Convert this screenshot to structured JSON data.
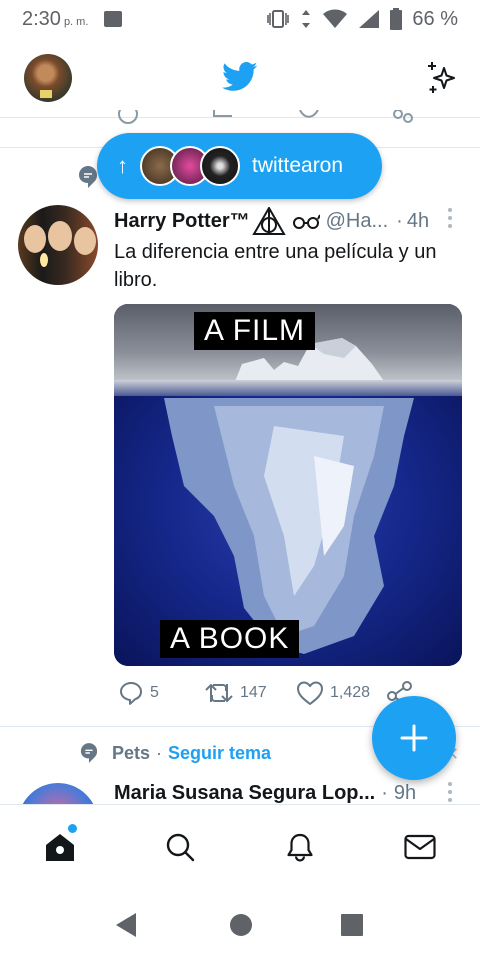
{
  "status_bar": {
    "time": "2:30",
    "ampm": "p. m.",
    "battery": "66 %"
  },
  "header": {
    "logo_icon": "twitter-bird-icon",
    "right_icon": "sparkle-icon"
  },
  "new_tweets_pill": {
    "arrow": "↑",
    "label": "twittearon"
  },
  "tweets": [
    {
      "name": "Harry Potter™",
      "badges": "⚠∞",
      "handle": "@Ha...",
      "time": "4h",
      "text": "La diferencia entre una película y un libro.",
      "media": {
        "caption_top": "A FILM",
        "caption_bottom": "A BOOK"
      },
      "replies": "5",
      "retweets": "147",
      "likes": "1,428"
    }
  ],
  "topic": {
    "name": "Pets",
    "follow": "Seguir tema",
    "separator": "·"
  },
  "tweet2": {
    "name": "Maria Susana Segura Lop...",
    "time": "9h"
  },
  "colors": {
    "accent": "#1da1f2",
    "text_primary": "#14171a",
    "text_secondary": "#657786",
    "divider": "#e1e8ed"
  },
  "bottom_nav": [
    "home-icon",
    "search-icon",
    "notifications-bell-icon",
    "messages-envelope-icon"
  ],
  "system_nav": [
    "back-icon",
    "home-circle-icon",
    "recents-square-icon"
  ]
}
